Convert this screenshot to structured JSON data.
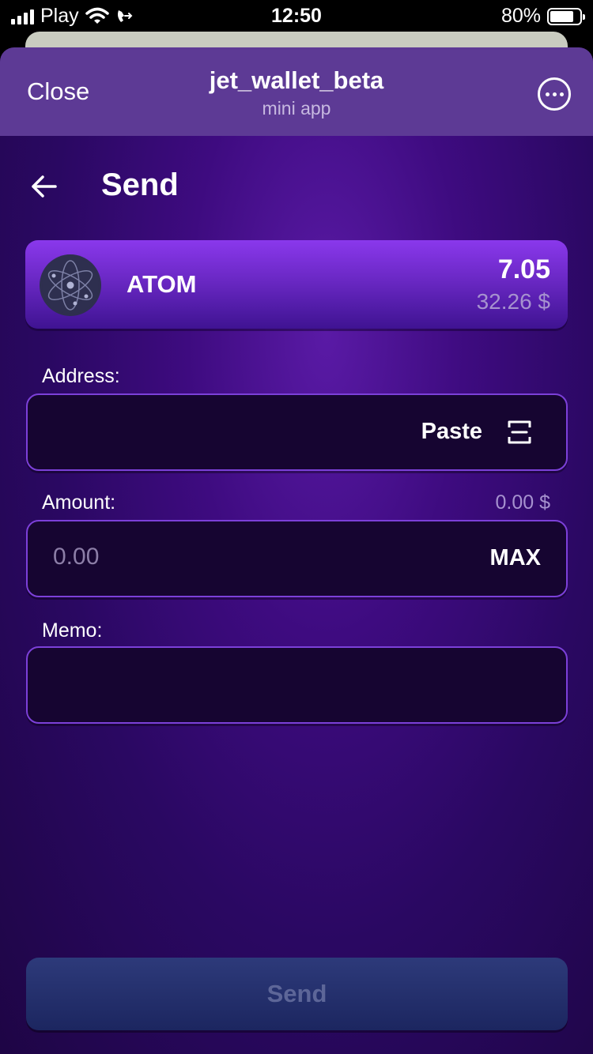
{
  "status_bar": {
    "carrier": "Play",
    "time": "12:50",
    "battery_percent": "80%",
    "battery_level": 0.8,
    "icons": [
      "signal-icon",
      "wifi-icon",
      "call-forwarding-icon",
      "battery-icon"
    ]
  },
  "topbar": {
    "close_label": "Close",
    "title": "jet_wallet_beta",
    "subtitle": "mini app",
    "more_icon": "more-options-icon"
  },
  "page": {
    "back_icon": "arrow-left-icon",
    "title": "Send"
  },
  "token": {
    "name": "ATOM",
    "amount": "7.05",
    "fiat_value": "32.26 $",
    "logo_icon": "cosmos-atom-icon"
  },
  "address": {
    "label": "Address:",
    "value": "",
    "paste_label": "Paste",
    "scan_icon": "scan-icon"
  },
  "amount": {
    "label": "Amount:",
    "fiat_value": "0.00 $",
    "placeholder": "0.00",
    "max_label": "MAX"
  },
  "memo": {
    "label": "Memo:",
    "value": ""
  },
  "send_button": {
    "label": "Send"
  },
  "colors": {
    "topbar": "#5d3a95",
    "background_top": "#5a1aa6",
    "background_bottom": "#1e0545",
    "field_bg": "#160531",
    "field_border": "#7c40d9",
    "card_accent": "#8a38ec",
    "send_button": "#2d3a7a",
    "muted_text": "#a692cf"
  }
}
